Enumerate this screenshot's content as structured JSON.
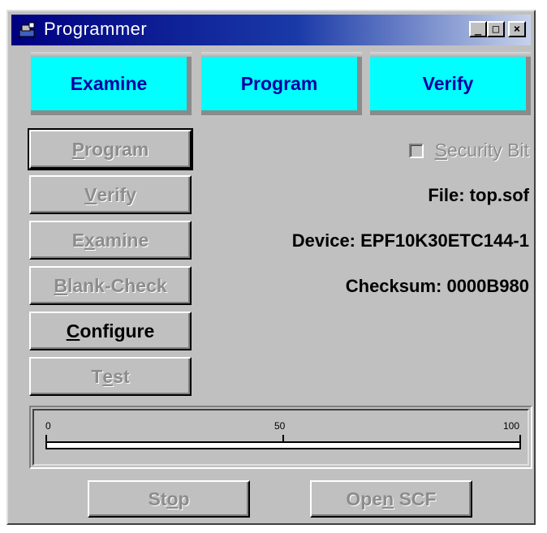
{
  "window": {
    "title": "Programmer"
  },
  "caption_buttons": {
    "minimize": "_",
    "maximize": "□",
    "close": "×"
  },
  "mode_tabs": [
    {
      "label": "Examine"
    },
    {
      "label": "Program"
    },
    {
      "label": "Verify"
    }
  ],
  "action_buttons": [
    {
      "pre": "",
      "key": "P",
      "post": "rogram",
      "state": "disabled"
    },
    {
      "pre": "",
      "key": "V",
      "post": "erify",
      "state": "disabled"
    },
    {
      "pre": "E",
      "key": "x",
      "post": "amine",
      "state": "disabled"
    },
    {
      "pre": "",
      "key": "B",
      "post": "lank-Check",
      "state": "disabled"
    },
    {
      "pre": "",
      "key": "C",
      "post": "onfigure",
      "state": "enabled"
    },
    {
      "pre": "T",
      "key": "e",
      "post": "st",
      "state": "disabled"
    }
  ],
  "security_bit": {
    "pre": "",
    "key": "S",
    "post": "ecurity Bit",
    "checked": false,
    "state": "disabled"
  },
  "info": {
    "file": "File: top.sof",
    "device": "Device: EPF10K30ETC144-1",
    "checksum": "Checksum: 0000B980"
  },
  "progress": {
    "scale_min": "0",
    "scale_mid": "50",
    "scale_max": "100",
    "value": 0
  },
  "bottom_buttons": {
    "stop": {
      "pre": "St",
      "key": "o",
      "post": "p"
    },
    "open_scf": {
      "pre": "Ope",
      "key": "n",
      "post": " SCF"
    }
  }
}
